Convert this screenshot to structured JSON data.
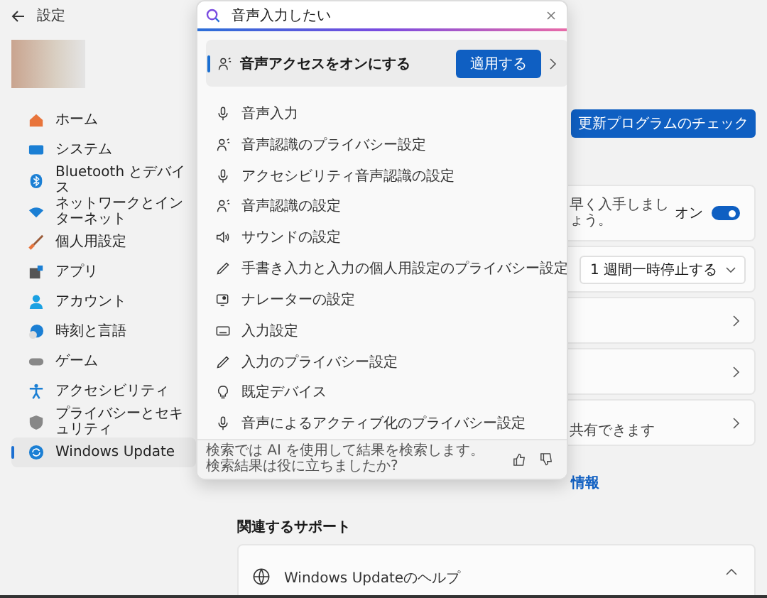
{
  "sidebar": {
    "title": "設定",
    "items": [
      {
        "label": "ホーム",
        "kind": "home",
        "selected": false
      },
      {
        "label": "システム",
        "kind": "system",
        "selected": false
      },
      {
        "label": "Bluetooth とデバイス",
        "kind": "bluetooth",
        "selected": false
      },
      {
        "label": "ネットワークとインターネット",
        "kind": "network",
        "selected": false
      },
      {
        "label": "個人用設定",
        "kind": "brush",
        "selected": false
      },
      {
        "label": "アプリ",
        "kind": "apps",
        "selected": false
      },
      {
        "label": "アカウント",
        "kind": "account",
        "selected": false
      },
      {
        "label": "時刻と言語",
        "kind": "time",
        "selected": false
      },
      {
        "label": "ゲーム",
        "kind": "game",
        "selected": false
      },
      {
        "label": "アクセシビリティ",
        "kind": "accessibility",
        "selected": false
      },
      {
        "label": "プライバシーとセキュリティ",
        "kind": "shield",
        "selected": false
      },
      {
        "label": "Windows Update",
        "kind": "update",
        "selected": true
      }
    ]
  },
  "search": {
    "value": "音声入力したい",
    "top_result": {
      "label": "音声アクセスをオンにする",
      "button": "適用する"
    },
    "results": [
      {
        "label": "音声入力",
        "kind": "mic"
      },
      {
        "label": "音声認識のプライバシー設定",
        "kind": "voice"
      },
      {
        "label": "アクセシビリティ音声認識の設定",
        "kind": "mic"
      },
      {
        "label": "音声認識の設定",
        "kind": "voice"
      },
      {
        "label": "サウンドの設定",
        "kind": "speaker"
      },
      {
        "label": "手書き入力と入力の個人用設定のプライバシー設定",
        "kind": "pen"
      },
      {
        "label": "ナレーターの設定",
        "kind": "narrator"
      },
      {
        "label": "入力設定",
        "kind": "keyboard"
      },
      {
        "label": "入力のプライバシー設定",
        "kind": "pen"
      },
      {
        "label": "既定デバイス",
        "kind": "device"
      },
      {
        "label": "音声によるアクティブ化のプライバシー設定",
        "kind": "mic"
      }
    ],
    "feedback": "検索では AI を使用して結果を検索します。検索結果は役に立ちましたか?"
  },
  "main": {
    "check_button": "更新プログラムのチェック",
    "cards": [
      {
        "kind": "toggle",
        "text": "早く入手しましょう。",
        "state": "オン",
        "on": true
      },
      {
        "kind": "dropdown",
        "value": "1 週間一時停止する"
      },
      {
        "kind": "link"
      },
      {
        "kind": "link"
      },
      {
        "kind": "link",
        "text": "共有できます"
      }
    ],
    "link_fragment": "情報",
    "support_heading": "関連するサポート",
    "help_card": {
      "title": "Windows Updateのヘルプ",
      "expanded": true
    }
  }
}
